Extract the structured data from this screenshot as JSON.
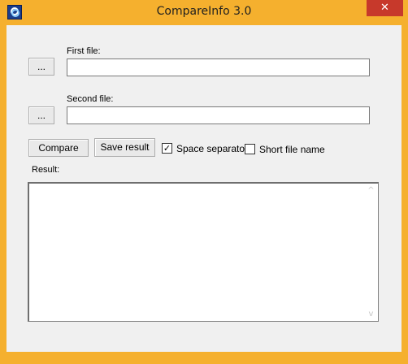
{
  "window": {
    "title": "CompareInfo 3.0",
    "close_glyph": "✕",
    "app_icon": "compareinfo-app-icon"
  },
  "first_file": {
    "label": "First file:",
    "value": "",
    "browse_label": "..."
  },
  "second_file": {
    "label": "Second file:",
    "value": "",
    "browse_label": "..."
  },
  "actions": {
    "compare_label": "Compare",
    "save_result_label": "Save result"
  },
  "options": {
    "space_separator": {
      "label": "Space separator",
      "checked": true
    },
    "short_file_name": {
      "label": "Short file name",
      "checked": false
    }
  },
  "result": {
    "label": "Result:",
    "value": ""
  },
  "scrollbar": {
    "up_glyph": "^",
    "down_glyph": "v"
  },
  "colors": {
    "titlebar": "#f5b02e",
    "close_button": "#c7392b",
    "client_bg": "#f0f0f0"
  }
}
